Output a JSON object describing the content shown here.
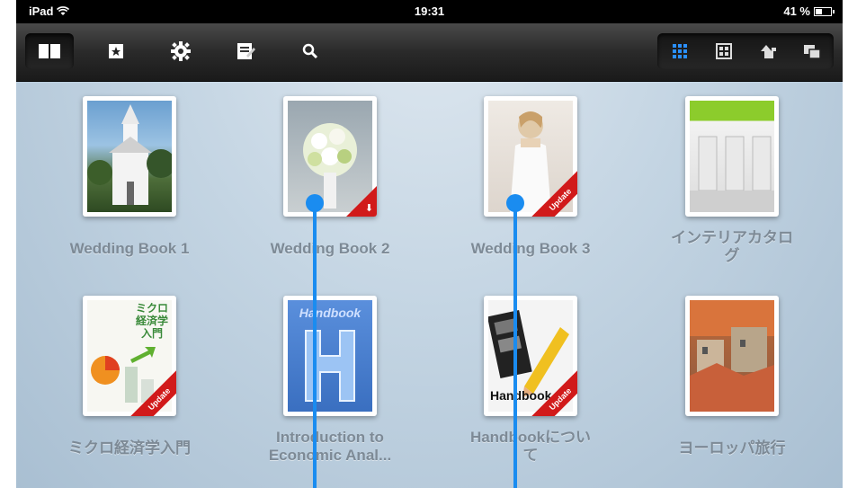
{
  "status": {
    "device": "iPad",
    "time": "19:31",
    "battery": "41 %"
  },
  "toolbar": {
    "left_icons": [
      "book-open-icon",
      "bookmark-star-icon",
      "gear-icon",
      "notes-icon",
      "search-icon"
    ],
    "view_icons": [
      "grid-view-icon",
      "list-view-icon",
      "store-icon",
      "share-icon"
    ]
  },
  "books": [
    {
      "title": "Wedding Book 1",
      "badge": "",
      "art": "church"
    },
    {
      "title": "Wedding Book 2",
      "badge": "download",
      "art": "bouquet"
    },
    {
      "title": "Wedding Book 3",
      "badge": "Update",
      "art": "bride"
    },
    {
      "title": "インテリアカタロ\nグ",
      "badge": "",
      "art": "interior"
    },
    {
      "title": "ミクロ経済学入門",
      "badge": "Update",
      "art": "micro",
      "cover_text": "ミクロ\n経済学\n入門"
    },
    {
      "title": "Introduction to\nEconomic Anal...",
      "badge": "",
      "art": "handbook",
      "cover_text": "Handbook"
    },
    {
      "title": "Handbookについ\nて",
      "badge": "Update",
      "art": "film",
      "cover_text": "Handbook"
    },
    {
      "title": "ヨーロッパ旅行",
      "badge": "",
      "art": "town"
    }
  ],
  "colors": {
    "accent": "#1a8cf0",
    "badge": "#d11a1a"
  }
}
